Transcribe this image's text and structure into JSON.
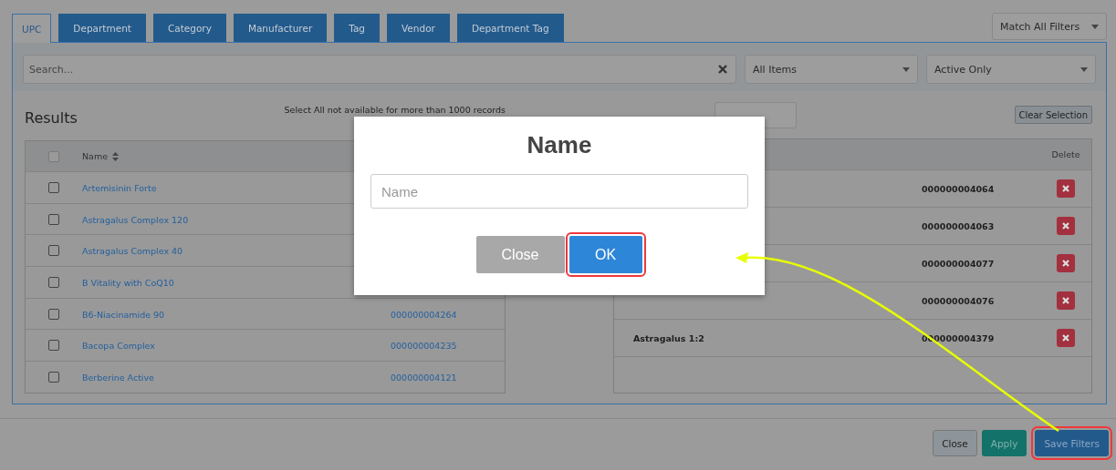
{
  "tabs": [
    {
      "label": "UPC",
      "selected": true
    },
    {
      "label": "Department",
      "selected": false
    },
    {
      "label": "Category",
      "selected": false
    },
    {
      "label": "Manufacturer",
      "selected": false
    },
    {
      "label": "Tag",
      "selected": false
    },
    {
      "label": "Vendor",
      "selected": false
    },
    {
      "label": "Department Tag",
      "selected": false
    }
  ],
  "match_filter": {
    "value": "Match All Filters"
  },
  "search": {
    "placeholder": "Search..."
  },
  "filters": [
    {
      "value": "All Items"
    },
    {
      "value": "Active Only"
    }
  ],
  "results": {
    "title": "Results",
    "header_checkbox": {
      "disabled": true
    },
    "note": "Select All not available for more than 1000 records",
    "name_column": "Name",
    "rows": [
      {
        "name": "Artemisinin Forte",
        "checked": false
      },
      {
        "name": "Astragalus Complex 120",
        "checked": false
      },
      {
        "name": "Astragalus Complex 40",
        "checked": false
      },
      {
        "name": "B Vitality with CoQ10",
        "checked": false
      },
      {
        "name": "B6-Niacinamide 90",
        "upc": "000000004264",
        "checked": false
      },
      {
        "name": "Bacopa Complex",
        "upc": "000000004235",
        "checked": false
      },
      {
        "name": "Berberine Active",
        "upc": "000000004121",
        "checked": false
      }
    ]
  },
  "selected_list": {
    "clear_button": "Clear Selection",
    "delete_column": "Delete",
    "rows": [
      {
        "upc": "000000004064"
      },
      {
        "upc": "000000004063"
      },
      {
        "upc": "000000004077"
      },
      {
        "upc": "000000004076"
      },
      {
        "name": "Astragalus 1:2",
        "upc": "000000004379"
      }
    ]
  },
  "footer_buttons": [
    {
      "label": "Close",
      "kind": "default",
      "highlighted": false
    },
    {
      "label": "Apply",
      "kind": "success",
      "highlighted": false
    },
    {
      "label": "Save Filters",
      "kind": "primary",
      "highlighted": true
    }
  ],
  "modal": {
    "title": "Name",
    "field": {
      "placeholder": "Name"
    },
    "buttons": [
      {
        "label": "Close",
        "kind": "default",
        "highlighted": false
      },
      {
        "label": "OK",
        "kind": "primary",
        "highlighted": true
      }
    ]
  }
}
